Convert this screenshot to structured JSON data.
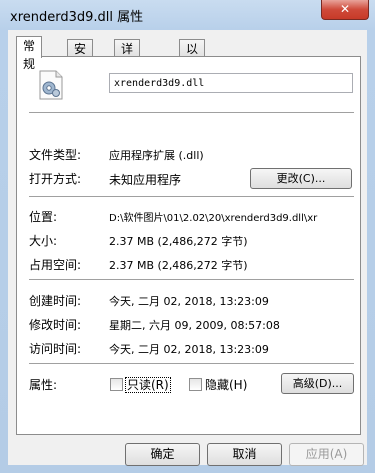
{
  "window": {
    "title": "xrenderd3d9.dll 属性",
    "close_label": "✕"
  },
  "tabs": [
    {
      "label": "常规"
    },
    {
      "label": "安全"
    },
    {
      "label": "详细信息"
    },
    {
      "label": "以前的版本"
    }
  ],
  "general": {
    "file_name": "xrenderd3d9.dll",
    "file_type_label": "文件类型:",
    "file_type_value": "应用程序扩展 (.dll)",
    "opens_with_label": "打开方式:",
    "opens_with_value": "未知应用程序",
    "change_button": "更改(C)...",
    "location_label": "位置:",
    "location_value": "D:\\软件图片\\01\\2.02\\20\\xrenderd3d9.dll\\xr",
    "size_label": "大小:",
    "size_value": "2.37 MB (2,486,272 字节)",
    "size_on_disk_label": "占用空间:",
    "size_on_disk_value": "2.37 MB (2,486,272 字节)",
    "created_label": "创建时间:",
    "created_value": "今天, 二月 02, 2018, 13:23:09",
    "modified_label": "修改时间:",
    "modified_value": "星期二, 六月 09, 2009, 08:57:08",
    "accessed_label": "访问时间:",
    "accessed_value": "今天, 二月 02, 2018, 13:23:09",
    "attributes_label": "属性:",
    "readonly_label": "只读(R)",
    "hidden_label": "隐藏(H)",
    "advanced_button": "高级(D)..."
  },
  "footer": {
    "ok": "确定",
    "cancel": "取消",
    "apply": "应用(A)"
  },
  "icons": {
    "file_icon": "dll-gear-file-icon"
  }
}
